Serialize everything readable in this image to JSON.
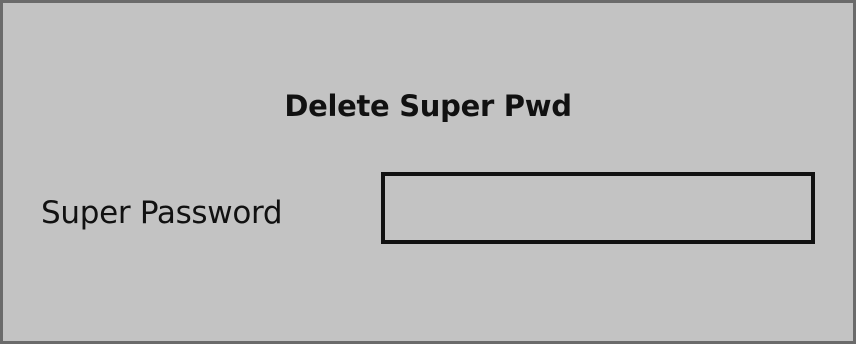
{
  "dialog": {
    "title": "Delete Super Pwd",
    "field_label": "Super Password",
    "password_value": "",
    "password_placeholder": ""
  },
  "colors": {
    "background": "#c3c3c3",
    "frame_border": "#6b6b6b",
    "input_border": "#111111",
    "text": "#111111"
  }
}
